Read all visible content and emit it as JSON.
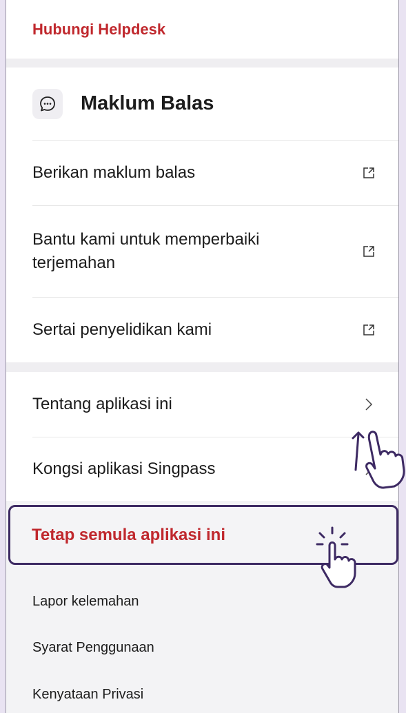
{
  "helpdesk": {
    "label": "Hubungi Helpdesk"
  },
  "feedback_section": {
    "title": "Maklum Balas",
    "icon": "chat-bubble-icon",
    "items": [
      {
        "label": "Berikan maklum balas",
        "icon": "external-link-icon"
      },
      {
        "label": "Bantu kami untuk memperbaiki terjemahan",
        "icon": "external-link-icon"
      },
      {
        "label": "Sertai penyelidikan kami",
        "icon": "external-link-icon"
      }
    ]
  },
  "app_section": {
    "items": [
      {
        "label": "Tentang aplikasi ini",
        "icon": "chevron-right-icon"
      },
      {
        "label": "Kongsi aplikasi Singpass",
        "icon": "chevron-right-icon"
      }
    ]
  },
  "reset": {
    "label": "Tetap semula aplikasi ini"
  },
  "footer_links": [
    {
      "label": "Lapor kelemahan"
    },
    {
      "label": "Syarat Penggunaan"
    },
    {
      "label": "Kenyataan Privasi"
    }
  ],
  "colors": {
    "accent_red": "#c0282d",
    "highlight_border": "#3d2a63",
    "background": "#e9e3f2"
  }
}
